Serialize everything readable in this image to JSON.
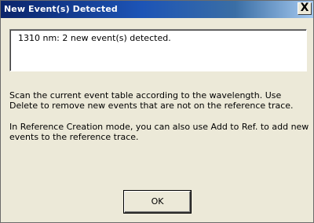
{
  "window": {
    "title": "New Event(s) Detected",
    "close_icon": "close-icon",
    "close_glyph": "X"
  },
  "message": {
    "text": "1310 nm: 2 new event(s) detected."
  },
  "info": {
    "paragraph1": "Scan the current event table according to the wavelength. Use Delete to remove new events that are not on the reference trace.",
    "paragraph2": "In Reference Creation mode, you can also use Add to Ref. to add new events to the reference trace."
  },
  "buttons": {
    "ok_label": "OK"
  },
  "colors": {
    "dialog_background": "#ece9d8",
    "titlebar_start": "#0a246a",
    "titlebar_end": "#a6caf0",
    "title_text": "#ffffff"
  }
}
